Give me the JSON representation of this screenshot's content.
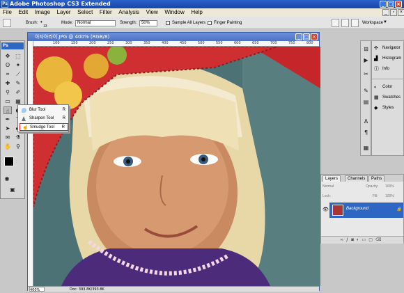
{
  "app": {
    "title": "Adobe Photoshop CS3 Extended",
    "logo": "Ps"
  },
  "menu": [
    "File",
    "Edit",
    "Image",
    "Layer",
    "Select",
    "Filter",
    "Analysis",
    "View",
    "Window",
    "Help"
  ],
  "options": {
    "brush_label": "Brush:",
    "brush_size": "13",
    "mode_label": "Mode:",
    "mode_value": "Normal",
    "strength_label": "Strength:",
    "strength_value": "50%",
    "sample_all_layers": "Sample All Layers",
    "finger_painting": "Finger Painting",
    "workspace_label": "Workspace"
  },
  "toolbox": {
    "badge": "Ps"
  },
  "flyout": {
    "items": [
      {
        "label": "Blur Tool",
        "key": "R"
      },
      {
        "label": "Sharpen Tool",
        "key": "R"
      },
      {
        "label": "Smudge Tool",
        "key": "R"
      }
    ]
  },
  "document": {
    "title": "아자아라이.JPG @ 400% (RGB/8)",
    "zoom": "400%",
    "doc_info": "Doc: 393.8K/393.8K",
    "ruler_labels": [
      "100",
      "150",
      "200",
      "250",
      "300",
      "350",
      "400",
      "450",
      "500",
      "550",
      "600",
      "650",
      "700",
      "750",
      "800"
    ]
  },
  "panels": {
    "items": [
      {
        "label": "Navigator",
        "icon": "navigator-icon"
      },
      {
        "label": "Histogram",
        "icon": "histogram-icon"
      },
      {
        "label": "Info",
        "icon": "info-icon"
      },
      {
        "label": "Color",
        "icon": "color-icon"
      },
      {
        "label": "Swatches",
        "icon": "swatches-icon"
      },
      {
        "label": "Styles",
        "icon": "styles-icon"
      }
    ]
  },
  "layers": {
    "tabs": [
      "Layers",
      "Channels",
      "Paths"
    ],
    "blend_mode": "Normal",
    "opacity_label": "Opacity:",
    "opacity_value": "100%",
    "lock_label": "Lock:",
    "fill_label": "Fill:",
    "fill_value": "100%",
    "layer_name": "Background"
  },
  "colors": {
    "accent": "#2e66c4",
    "titlebar": "#1a46a8",
    "selection_outline": "#e02020"
  }
}
